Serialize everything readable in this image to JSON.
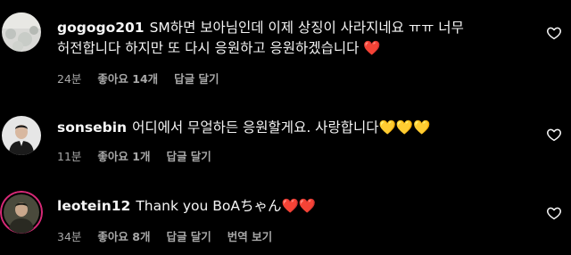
{
  "comments": [
    {
      "username": "gogogo201",
      "text1": "SM하면 보아님인데 이제 상징이 사라지네요 ㅠㅠ 너무",
      "text2": "허전합니다 하지만 또 다시 응원하고 응원하겠습니다",
      "emoji": "❤️",
      "time": "24분",
      "likes": "좋아요 14개",
      "reply": "답글 달기",
      "avatar_icon": "gray-rock-photo"
    },
    {
      "username": "sonsebin",
      "text1": "어디에서 무얼하든 응원할게요. 사랑합니다",
      "emoji": "💛💛💛",
      "time": "11분",
      "likes": "좋아요 1개",
      "reply": "답글 달기",
      "avatar_icon": "man-in-suit-photo"
    },
    {
      "username": "leotein12",
      "text1": "Thank you BoAちゃん",
      "emoji": "❤️❤️",
      "time": "34분",
      "likes": "좋아요 8개",
      "reply": "답글 달기",
      "translate": "번역 보기",
      "avatar_icon": "story-ring-man-photo"
    }
  ],
  "colors": {
    "background": "#000000",
    "text": "#f5f5f5",
    "meta": "#a8a8a8",
    "story_ring": "#d62976"
  },
  "icons": {
    "like": "heart-outline-icon"
  }
}
